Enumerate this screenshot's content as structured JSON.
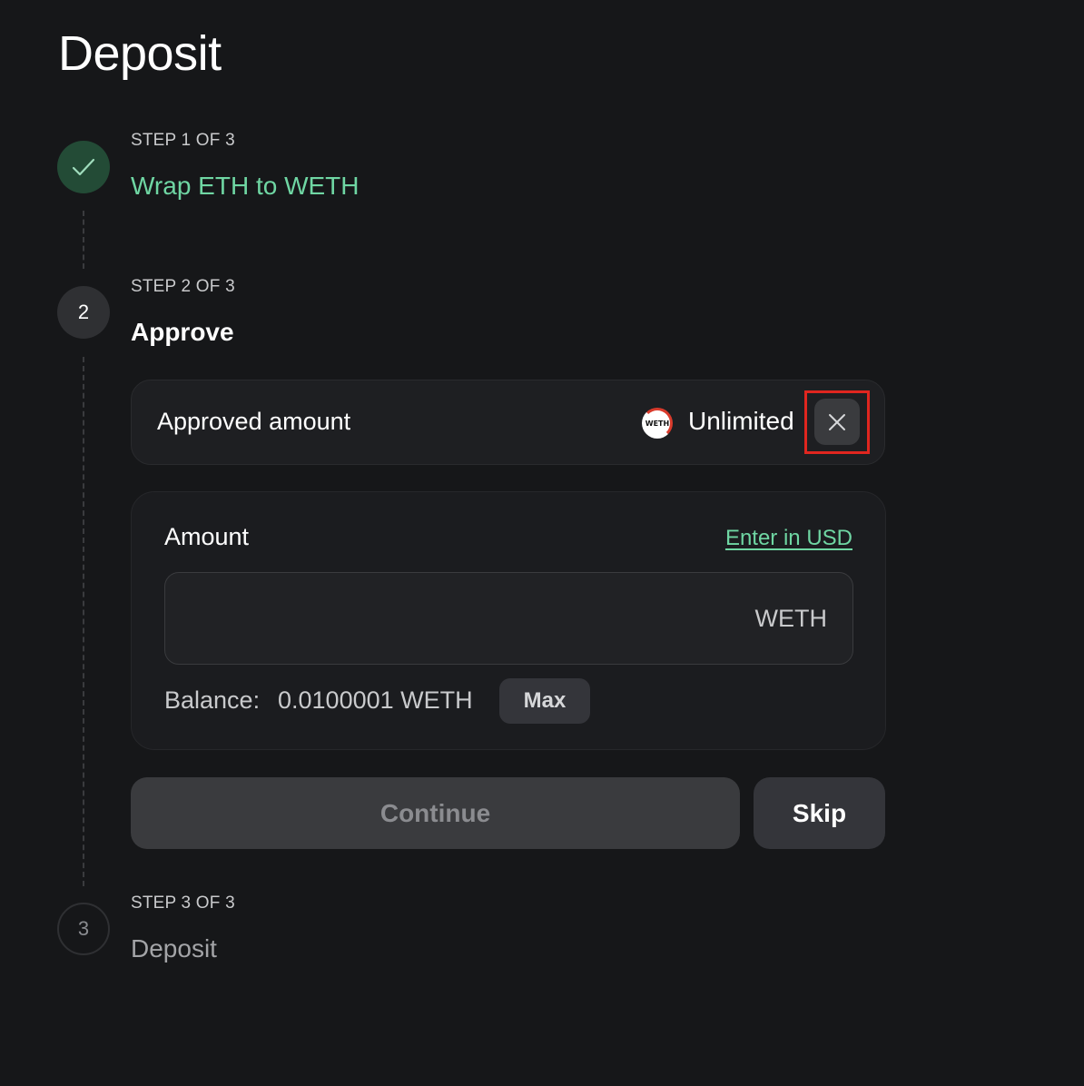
{
  "page": {
    "title": "Deposit"
  },
  "steps": [
    {
      "label": "STEP 1 OF 3",
      "title": "Wrap ETH to WETH",
      "status": "completed",
      "icon": "check-icon"
    },
    {
      "label": "STEP 2 OF 3",
      "title": "Approve",
      "status": "active",
      "number": "2"
    },
    {
      "label": "STEP 3 OF 3",
      "title": "Deposit",
      "status": "pending",
      "number": "3"
    }
  ],
  "approved": {
    "label": "Approved amount",
    "token_icon": "weth-token-icon",
    "token_icon_text": "WETH",
    "value": "Unlimited",
    "clear_icon": "close-icon"
  },
  "amount": {
    "label": "Amount",
    "usd_link": "Enter in USD",
    "input_value": "",
    "unit": "WETH",
    "balance_label": "Balance:",
    "balance_value": "0.0100001 WETH",
    "max_label": "Max"
  },
  "actions": {
    "continue_label": "Continue",
    "skip_label": "Skip"
  },
  "colors": {
    "background": "#161719",
    "accent_green": "#6fd6a3",
    "highlight_red": "#e0261f"
  }
}
